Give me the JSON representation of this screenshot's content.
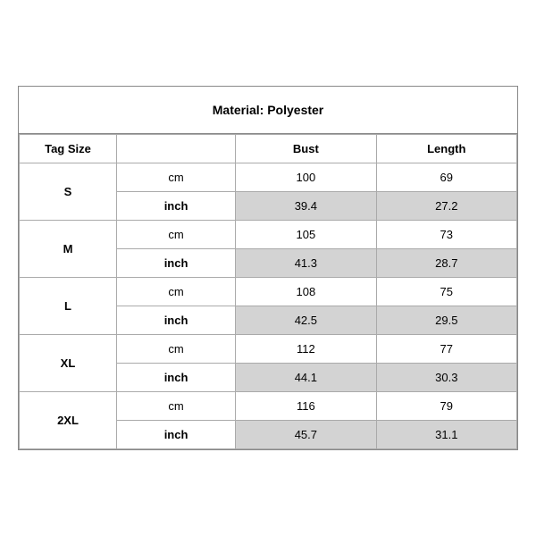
{
  "title": "Material: Polyester",
  "headers": {
    "tag_size": "Tag Size",
    "unit": "",
    "bust": "Bust",
    "length": "Length"
  },
  "rows": [
    {
      "size": "S",
      "cm": {
        "bust": "100",
        "length": "69"
      },
      "inch": {
        "bust": "39.4",
        "length": "27.2"
      }
    },
    {
      "size": "M",
      "cm": {
        "bust": "105",
        "length": "73"
      },
      "inch": {
        "bust": "41.3",
        "length": "28.7"
      }
    },
    {
      "size": "L",
      "cm": {
        "bust": "108",
        "length": "75"
      },
      "inch": {
        "bust": "42.5",
        "length": "29.5"
      }
    },
    {
      "size": "XL",
      "cm": {
        "bust": "112",
        "length": "77"
      },
      "inch": {
        "bust": "44.1",
        "length": "30.3"
      }
    },
    {
      "size": "2XL",
      "cm": {
        "bust": "116",
        "length": "79"
      },
      "inch": {
        "bust": "45.7",
        "length": "31.1"
      }
    }
  ],
  "units": {
    "cm": "cm",
    "inch": "inch"
  }
}
